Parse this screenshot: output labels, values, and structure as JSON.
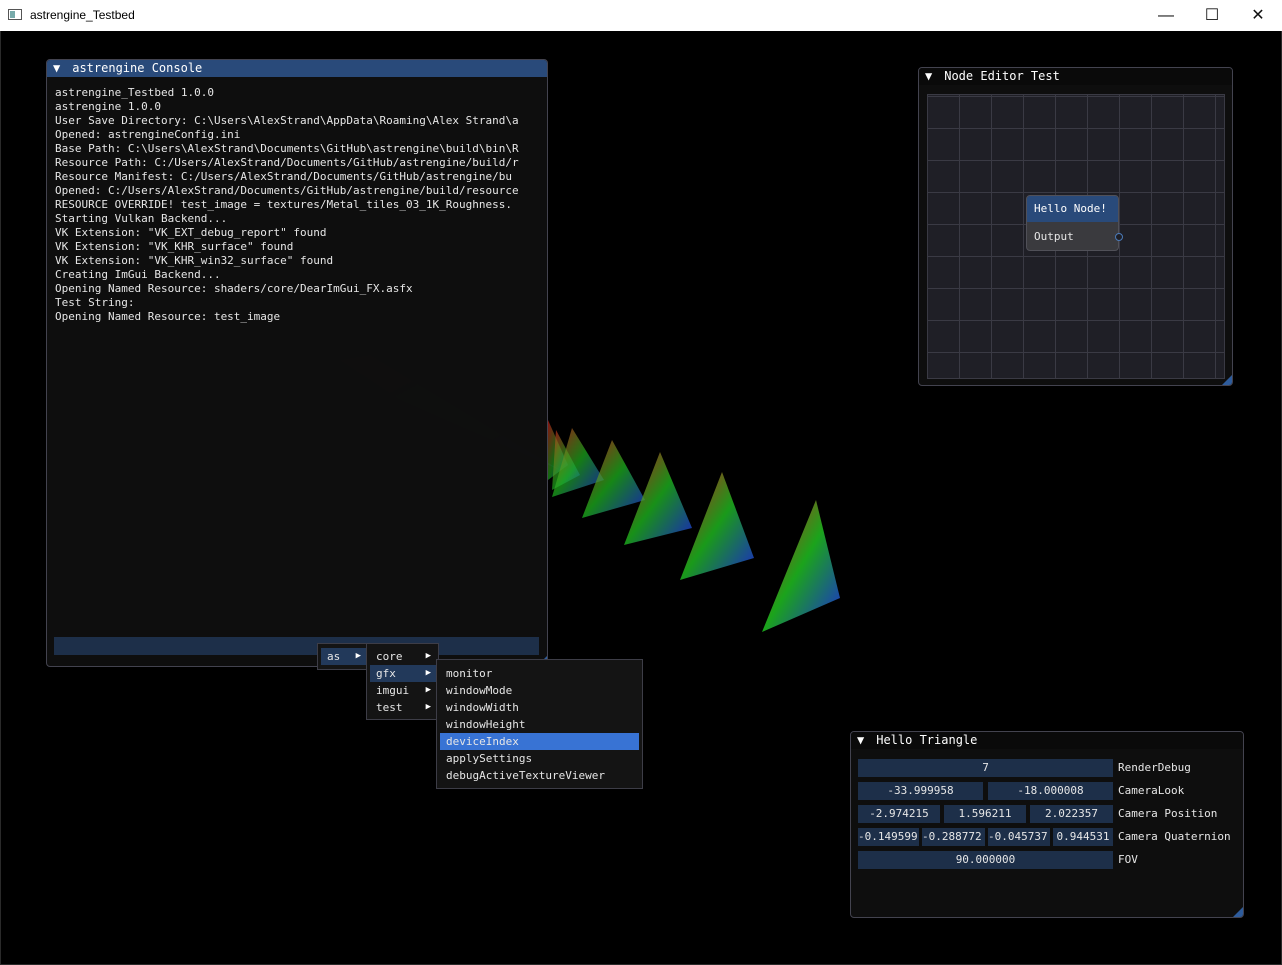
{
  "window": {
    "title": "astrengine_Testbed",
    "minimize_glyph": "—",
    "maximize_glyph": "☐",
    "close_glyph": "✕"
  },
  "console": {
    "title": "astrengine Console",
    "collapse_glyph": "▼",
    "lines": [
      "astrengine_Testbed 1.0.0",
      "astrengine 1.0.0",
      "User Save Directory: C:\\Users\\AlexStrand\\AppData\\Roaming\\Alex Strand\\a",
      "Opened: astrengineConfig.ini",
      "Base Path: C:\\Users\\AlexStrand\\Documents\\GitHub\\astrengine\\build\\bin\\R",
      "Resource Path: C:/Users/AlexStrand/Documents/GitHub/astrengine/build/r",
      "Resource Manifest: C:/Users/AlexStrand/Documents/GitHub/astrengine/bu",
      "Opened: C:/Users/AlexStrand/Documents/GitHub/astrengine/build/resource",
      "RESOURCE OVERRIDE! test_image = textures/Metal_tiles_03_1K_Roughness.",
      "Starting Vulkan Backend...",
      "VK Extension: \"VK_EXT_debug_report\" found",
      "VK Extension: \"VK_KHR_surface\" found",
      "VK Extension: \"VK_KHR_win32_surface\" found",
      "Creating ImGui Backend...",
      "Opening Named Resource: shaders/core/DearImGui_FX.asfx",
      "Test String:",
      "Opening Named Resource: test_image"
    ],
    "input_value": "",
    "horizontal_scroll_fraction": 0.72
  },
  "menus": {
    "arrow_glyph": "▶",
    "level1": [
      {
        "label": "as"
      }
    ],
    "level2": [
      {
        "label": "core"
      },
      {
        "label": "gfx"
      },
      {
        "label": "imgui"
      },
      {
        "label": "test"
      }
    ],
    "level3": [
      {
        "label": "monitor"
      },
      {
        "label": "windowMode"
      },
      {
        "label": "windowWidth"
      },
      {
        "label": "windowHeight"
      },
      {
        "label": "deviceIndex"
      },
      {
        "label": "applySettings"
      },
      {
        "label": "debugActiveTextureViewer"
      }
    ],
    "selected": "deviceIndex"
  },
  "node_editor": {
    "title": "Node Editor Test",
    "collapse_glyph": "▼",
    "node_title": "Hello Node!",
    "node_output": "Output"
  },
  "hello_triangle": {
    "title": "Hello Triangle",
    "collapse_glyph": "▼",
    "render_debug": {
      "value": "7",
      "label": "RenderDebug"
    },
    "camera_look": {
      "values": [
        "-33.999958",
        "-18.000008"
      ],
      "label": "CameraLook"
    },
    "camera_position": {
      "values": [
        "-2.974215",
        "1.596211",
        "2.022357"
      ],
      "label": "Camera Position"
    },
    "camera_quaternion": {
      "values": [
        "-0.149599",
        "-0.288772",
        "-0.045737",
        "0.944531"
      ],
      "label": "Camera Quaternion"
    },
    "fov": {
      "value": "90.000000",
      "label": "FOV"
    }
  },
  "colors": {
    "title_active": "#294a7a",
    "frame_bg": "#1d2f49",
    "selected": "#3873d4",
    "window_bg": "#0f0f0f",
    "background": "#000000"
  }
}
